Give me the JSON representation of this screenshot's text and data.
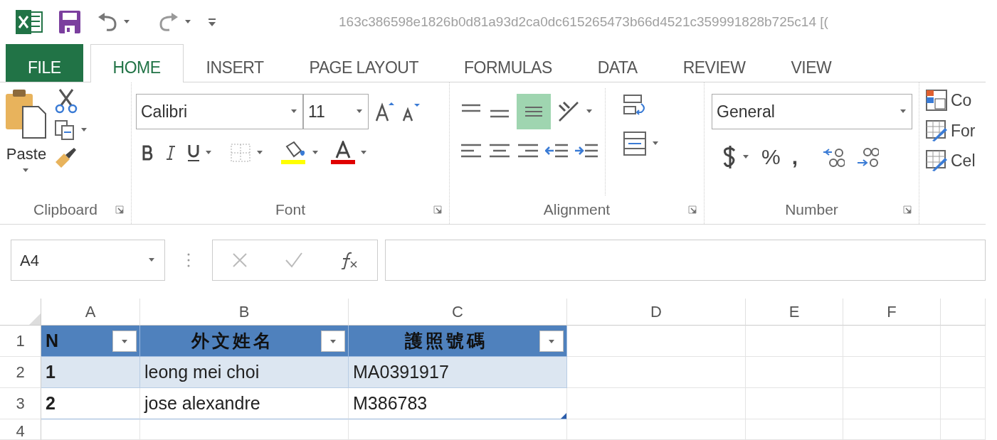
{
  "window": {
    "title": "163c386598e1826b0d81a93d2ca0dc615265473b66d4521c359991828b725c14  [("
  },
  "tabs": [
    {
      "label": "FILE",
      "kind": "file",
      "selected": false
    },
    {
      "label": "HOME",
      "kind": "tab",
      "selected": true
    },
    {
      "label": "INSERT",
      "kind": "tab",
      "selected": false
    },
    {
      "label": "PAGE LAYOUT",
      "kind": "tab",
      "selected": false
    },
    {
      "label": "FORMULAS",
      "kind": "tab",
      "selected": false
    },
    {
      "label": "DATA",
      "kind": "tab",
      "selected": false
    },
    {
      "label": "REVIEW",
      "kind": "tab",
      "selected": false
    },
    {
      "label": "VIEW",
      "kind": "tab",
      "selected": false
    }
  ],
  "ribbon": {
    "clipboard": {
      "label": "Clipboard",
      "paste": "Paste"
    },
    "font": {
      "label": "Font",
      "font_name": "Calibri",
      "font_size": "11"
    },
    "alignment": {
      "label": "Alignment",
      "middle_align": {
        "on": true
      }
    },
    "number": {
      "label": "Number",
      "format": "General",
      "percent": "%",
      "comma": ","
    },
    "styles": {
      "items": [
        "Co",
        "For",
        "Cel"
      ]
    }
  },
  "formula_bar": {
    "name_box": "A4"
  },
  "sheet": {
    "columns": [
      "A",
      "B",
      "C",
      "D",
      "E",
      "F"
    ],
    "rows": [
      {
        "header": "1",
        "kind": "table_header",
        "cells": [
          "N",
          "外文姓名",
          "護照號碼"
        ]
      },
      {
        "header": "2",
        "kind": "banded",
        "cells": [
          "1",
          "leong mei choi",
          "MA0391917"
        ]
      },
      {
        "header": "3",
        "kind": "plain",
        "cells": [
          "2",
          "jose alexandre",
          "M386783"
        ]
      },
      {
        "header": "4",
        "kind": "empty"
      }
    ]
  }
}
